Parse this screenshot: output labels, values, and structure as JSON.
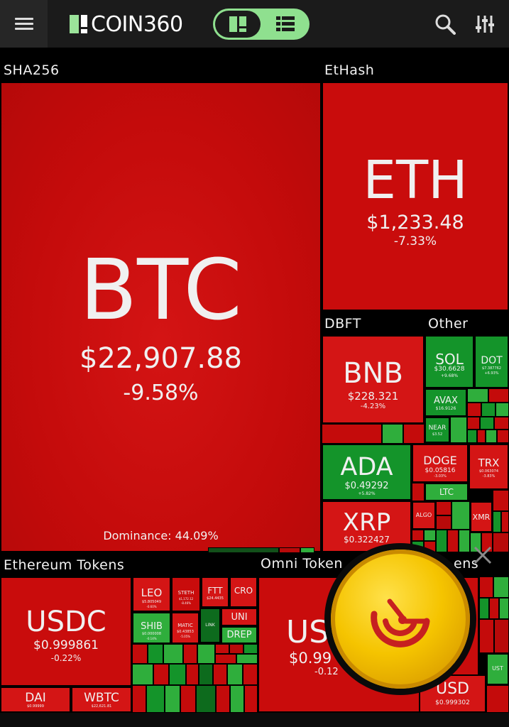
{
  "app": {
    "logo_text": "COIN360"
  },
  "header": {
    "menu_icon": "hamburger-menu-icon",
    "view_toggle": {
      "options": [
        "treemap-view-icon",
        "list-view-icon"
      ],
      "active": "treemap-view-icon"
    },
    "search_icon": "search-icon",
    "filter_icon": "sliders-icon"
  },
  "sections": {
    "sha256": "SHA256",
    "ethash": "EtHash",
    "dbft": "DBFT",
    "other": "Other",
    "ethereum_tokens": "Ethereum Tokens",
    "omni_tokens": "Omni Token",
    "hidden_partial": "ens"
  },
  "tiles": {
    "btc": {
      "symbol": "BTC",
      "price": "$22,907.88",
      "change": "-9.58%",
      "dominance": "Dominance: 44.09%"
    },
    "eth": {
      "symbol": "ETH",
      "price": "$1,233.48",
      "change": "-7.33%"
    },
    "bnb": {
      "symbol": "BNB",
      "price": "$228.321",
      "change": "-4.23%"
    },
    "ada": {
      "symbol": "ADA",
      "price": "$0.49292",
      "change": "+5.82%"
    },
    "xrp": {
      "symbol": "XRP",
      "price": "$0.322427"
    },
    "sol": {
      "symbol": "SOL",
      "price": "$30.6628",
      "change": "+9.68%"
    },
    "dot": {
      "symbol": "DOT",
      "price": "$7.387762",
      "change": "+6.93%"
    },
    "avax": {
      "symbol": "AVAX",
      "price": "$16.9126"
    },
    "near": {
      "symbol": "NEAR",
      "price": "$3.52"
    },
    "doge": {
      "symbol": "DOGE",
      "price": "$0.05816",
      "change": "-3.03%"
    },
    "trx": {
      "symbol": "TRX",
      "price": "$0.063074",
      "change": "-3.83%"
    },
    "ltc": {
      "symbol": "LTC"
    },
    "algo": {
      "symbol": "ALGO"
    },
    "xmr": {
      "symbol": "XMR"
    },
    "usdc": {
      "symbol": "USDC",
      "price": "$0.999861",
      "change": "-0.22%"
    },
    "dai": {
      "symbol": "DAI",
      "price": "$0.99999"
    },
    "wbtc": {
      "symbol": "WBTC",
      "price": "$22,621.81"
    },
    "leo": {
      "symbol": "LEO",
      "price": "$5.805049",
      "change": "-0.60%"
    },
    "steth": {
      "symbol": "STETH",
      "price": "$1,172.12",
      "change": "-8.46%"
    },
    "ftt": {
      "symbol": "FTT",
      "price": "$24.4435"
    },
    "cro": {
      "symbol": "CRO"
    },
    "shib": {
      "symbol": "SHIB",
      "price": "$0.000008",
      "change": "-0.14%"
    },
    "matic": {
      "symbol": "MATIC",
      "price": "$0.43853",
      "change": "-5.05%"
    },
    "link": {
      "symbol": "LINK"
    },
    "uni": {
      "symbol": "UNI"
    },
    "drep": {
      "symbol": "DREP"
    },
    "usdt": {
      "symbol": "US",
      "price": "$0.99",
      "change": "-0.12"
    },
    "usd_small": {
      "symbol": "USD",
      "price": "$0.999302"
    },
    "ust": {
      "symbol": "UST"
    }
  },
  "overlay": {
    "coin_button_icon": "coin-logo-icon",
    "close_icon": "close-icon"
  },
  "colors": {
    "red": "#c90c0c",
    "green": "#14942a",
    "accent_green": "#8fe08f",
    "coin_gold": "#f5c400"
  }
}
